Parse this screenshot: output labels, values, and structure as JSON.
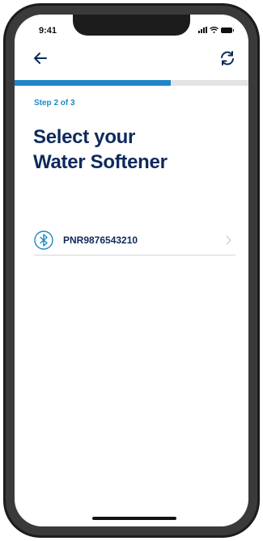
{
  "status_bar": {
    "time": "9:41"
  },
  "header": {
    "back_icon": "arrow-left-icon",
    "refresh_icon": "refresh-icon"
  },
  "progress": {
    "current_step": 2,
    "total_steps": 3,
    "fraction": 0.667,
    "fill_color": "#1f87c7"
  },
  "step_label": "Step 2 of 3",
  "title": {
    "line1": "Select your",
    "line2": "Water Softener"
  },
  "devices": [
    {
      "name": "PNR9876543210",
      "icon": "bluetooth-icon"
    }
  ],
  "colors": {
    "accent": "#1f87c7",
    "title": "#0e2a5c"
  }
}
